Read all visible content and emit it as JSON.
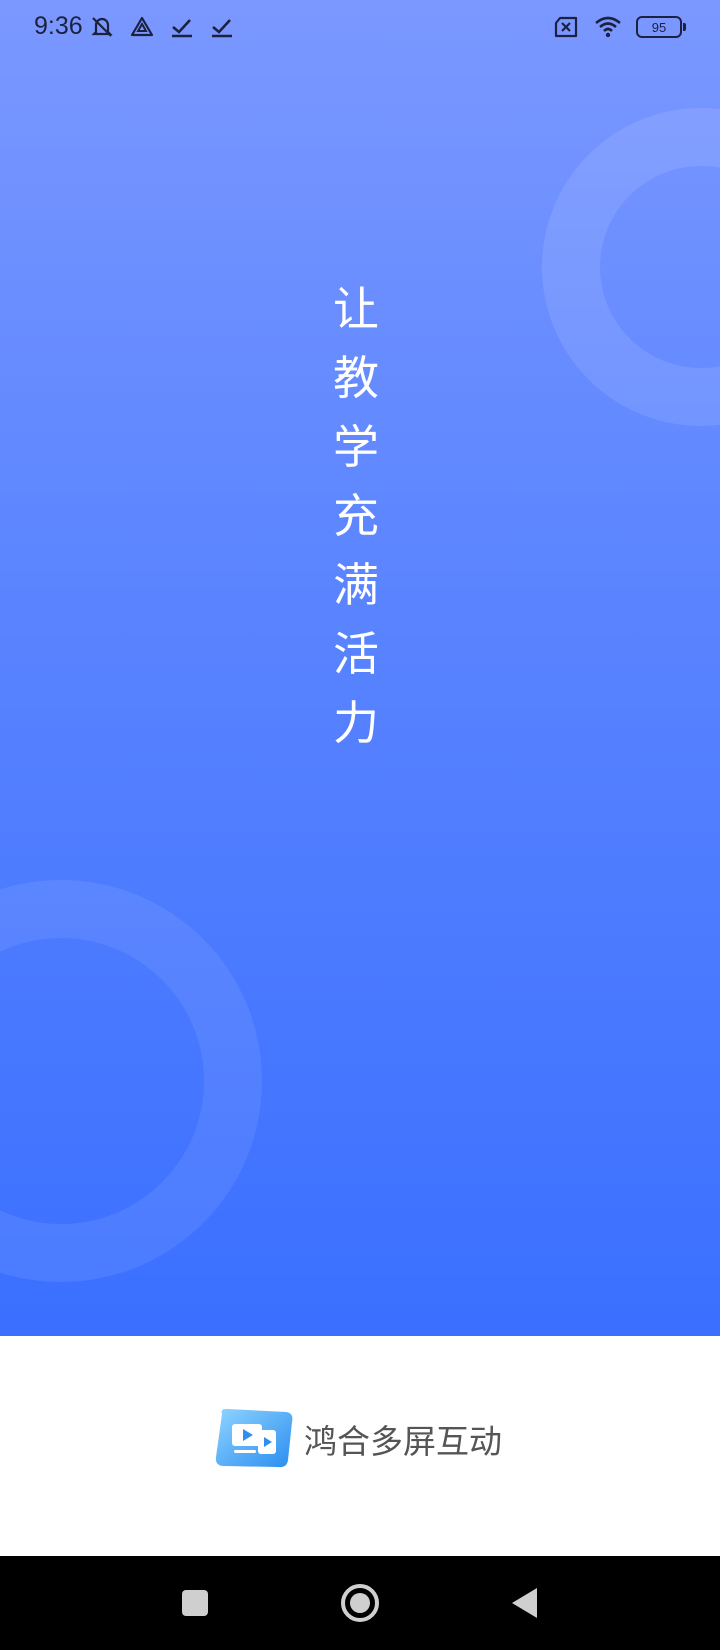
{
  "status_bar": {
    "time": "9:36",
    "left_icons": [
      "notifications-muted-icon",
      "drive-icon",
      "checkmark-icon",
      "checkmark-icon"
    ],
    "right_icons": [
      "no-sim-icon",
      "wifi-icon"
    ],
    "battery_level": "95"
  },
  "splash": {
    "slogan_chars": [
      "让",
      "教",
      "学",
      "充",
      "满",
      "活",
      "力"
    ],
    "gradient_top": "#7b98ff",
    "gradient_bottom": "#3a6fff"
  },
  "brand": {
    "name": "鸿合多屏互动",
    "logo_icon": "screen-share-logo-icon"
  },
  "nav_bar": {
    "icons": [
      "recent-apps-icon",
      "home-icon",
      "back-icon"
    ]
  }
}
